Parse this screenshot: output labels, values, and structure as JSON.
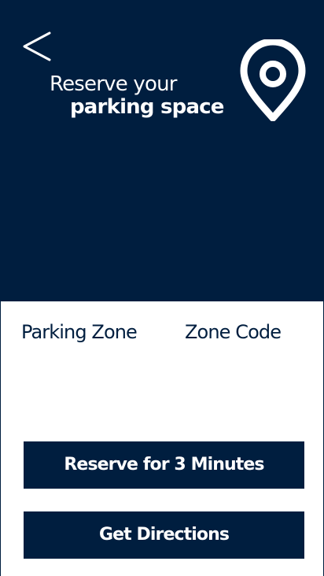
{
  "header": {
    "title_line1": "Reserve your",
    "title_line2": "parking space",
    "back_icon": "chevron-left-icon",
    "location_icon": "location-pin-icon"
  },
  "zone": {
    "parking_zone_label": "Parking Zone",
    "zone_code_label": "Zone Code"
  },
  "actions": {
    "reserve_label": "Reserve for 3 Minutes",
    "directions_label": "Get Directions"
  },
  "colors": {
    "primary": "#001e3f",
    "background": "#ffffff",
    "on_primary": "#ffffff"
  }
}
